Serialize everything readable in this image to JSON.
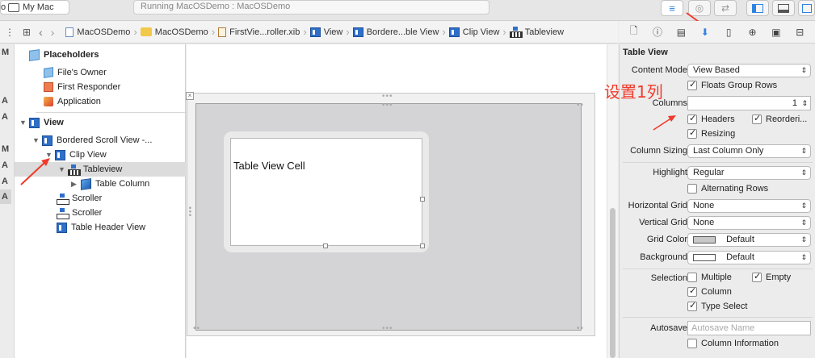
{
  "toolbar": {
    "scheme_prefix": "o",
    "scheme_label": "My Mac",
    "status": "Running MacOSDemo : MacOSDemo"
  },
  "jumpbar": {
    "items": [
      "MacOSDemo",
      "MacOSDemo",
      "FirstVie...roller.xib",
      "View",
      "Bordere...ble View",
      "Clip View",
      "Tableview"
    ]
  },
  "gutter": {
    "letters": [
      "M",
      "A",
      "A",
      "M",
      "A",
      "A",
      "A"
    ]
  },
  "outline": {
    "placeholders": "Placeholders",
    "files_owner": "File's Owner",
    "first_responder": "First Responder",
    "application": "Application",
    "view": "View",
    "bordered_scroll_view": "Bordered Scroll View -...",
    "clip_view": "Clip View",
    "tableview": "Tableview",
    "table_column": "Table Column",
    "scroller1": "Scroller",
    "scroller2": "Scroller",
    "table_header_view": "Table Header View"
  },
  "canvas": {
    "cell_label": "Table View Cell"
  },
  "annotation": "设置1列",
  "inspector": {
    "title": "Table View",
    "content_mode_label": "Content Mode",
    "content_mode_value": "View Based",
    "floats_group_rows": "Floats Group Rows",
    "columns_label": "Columns",
    "columns_value": "1",
    "headers": "Headers",
    "reordering": "Reorderi...",
    "resizing": "Resizing",
    "column_sizing_label": "Column Sizing",
    "column_sizing_value": "Last Column Only",
    "highlight_label": "Highlight",
    "highlight_value": "Regular",
    "alternating_rows": "Alternating Rows",
    "horizontal_grid_label": "Horizontal Grid",
    "horizontal_grid_value": "None",
    "vertical_grid_label": "Vertical Grid",
    "vertical_grid_value": "None",
    "grid_color_label": "Grid Color",
    "grid_color_value": "Default",
    "background_label": "Background",
    "background_value": "Default",
    "selection_label": "Selection",
    "multiple": "Multiple",
    "empty": "Empty",
    "column": "Column",
    "type_select": "Type Select",
    "autosave_label": "Autosave",
    "autosave_placeholder": "Autosave Name",
    "column_information": "Column Information"
  },
  "colors": {
    "accent": "#2f83e2",
    "annotation": "#ef3b2c",
    "grid_color_swatch": "#c8c8c8",
    "background_swatch": "#ffffff"
  }
}
